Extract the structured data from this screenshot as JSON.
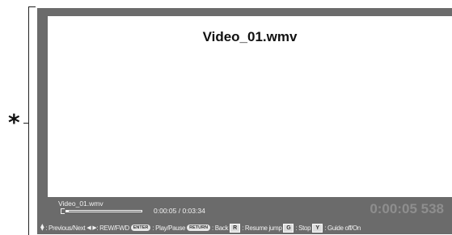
{
  "annotation": {
    "marker": "*"
  },
  "video": {
    "title": "Video_01.wmv"
  },
  "info": {
    "filename": "Video_01.wmv",
    "time": "0:00:05 / 0:03:34",
    "progress_fraction": 0.03,
    "big_time": "0:00:05 538"
  },
  "guide": {
    "prev_next": ": Previous/Next",
    "rew_fwd": ": REW/FWD",
    "enter_key": "ENTER",
    "play_pause": ": Play/Pause",
    "return_key": "RETURN",
    "back": ": Back",
    "r_key": "R",
    "resume": ": Resume jump",
    "g_key": "G",
    "stop": ": Stop",
    "y_key": "Y",
    "guide_toggle": ": Guide off/On"
  }
}
